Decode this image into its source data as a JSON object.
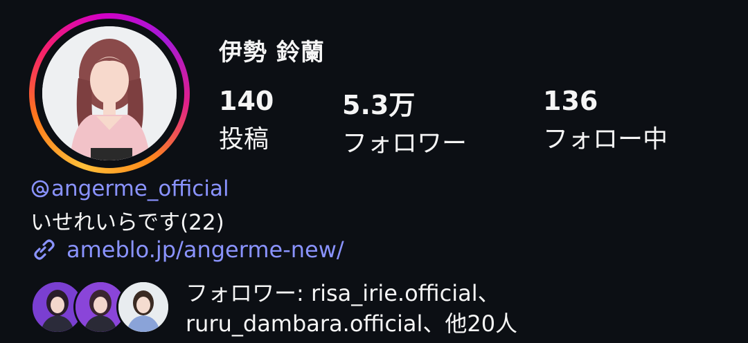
{
  "profile": {
    "display_name": "伊勢 鈴蘭",
    "avatar_icon": "profile-photo",
    "ring_colors": [
      "#ffbf3a",
      "#f5206b",
      "#d300c5"
    ]
  },
  "stats": {
    "posts": {
      "value": "140",
      "label": "投稿"
    },
    "followers": {
      "value": "5.3万",
      "label": "フォロワー"
    },
    "following": {
      "value": "136",
      "label": "フォロー中"
    }
  },
  "threads": {
    "icon": "threads-icon",
    "handle": "angerme_official"
  },
  "bio": {
    "text": "いせれいらです(22)"
  },
  "website": {
    "icon": "link-icon",
    "url_text": "ameblo.jp/angerme-new/"
  },
  "followed_by": {
    "line1": "フォロワー: risa_irie.official、",
    "line2": "ruru_dambara.official、他20人"
  },
  "colors": {
    "background": "#0c0f14",
    "link": "#8a93ff",
    "text": "#f5f5f5"
  }
}
